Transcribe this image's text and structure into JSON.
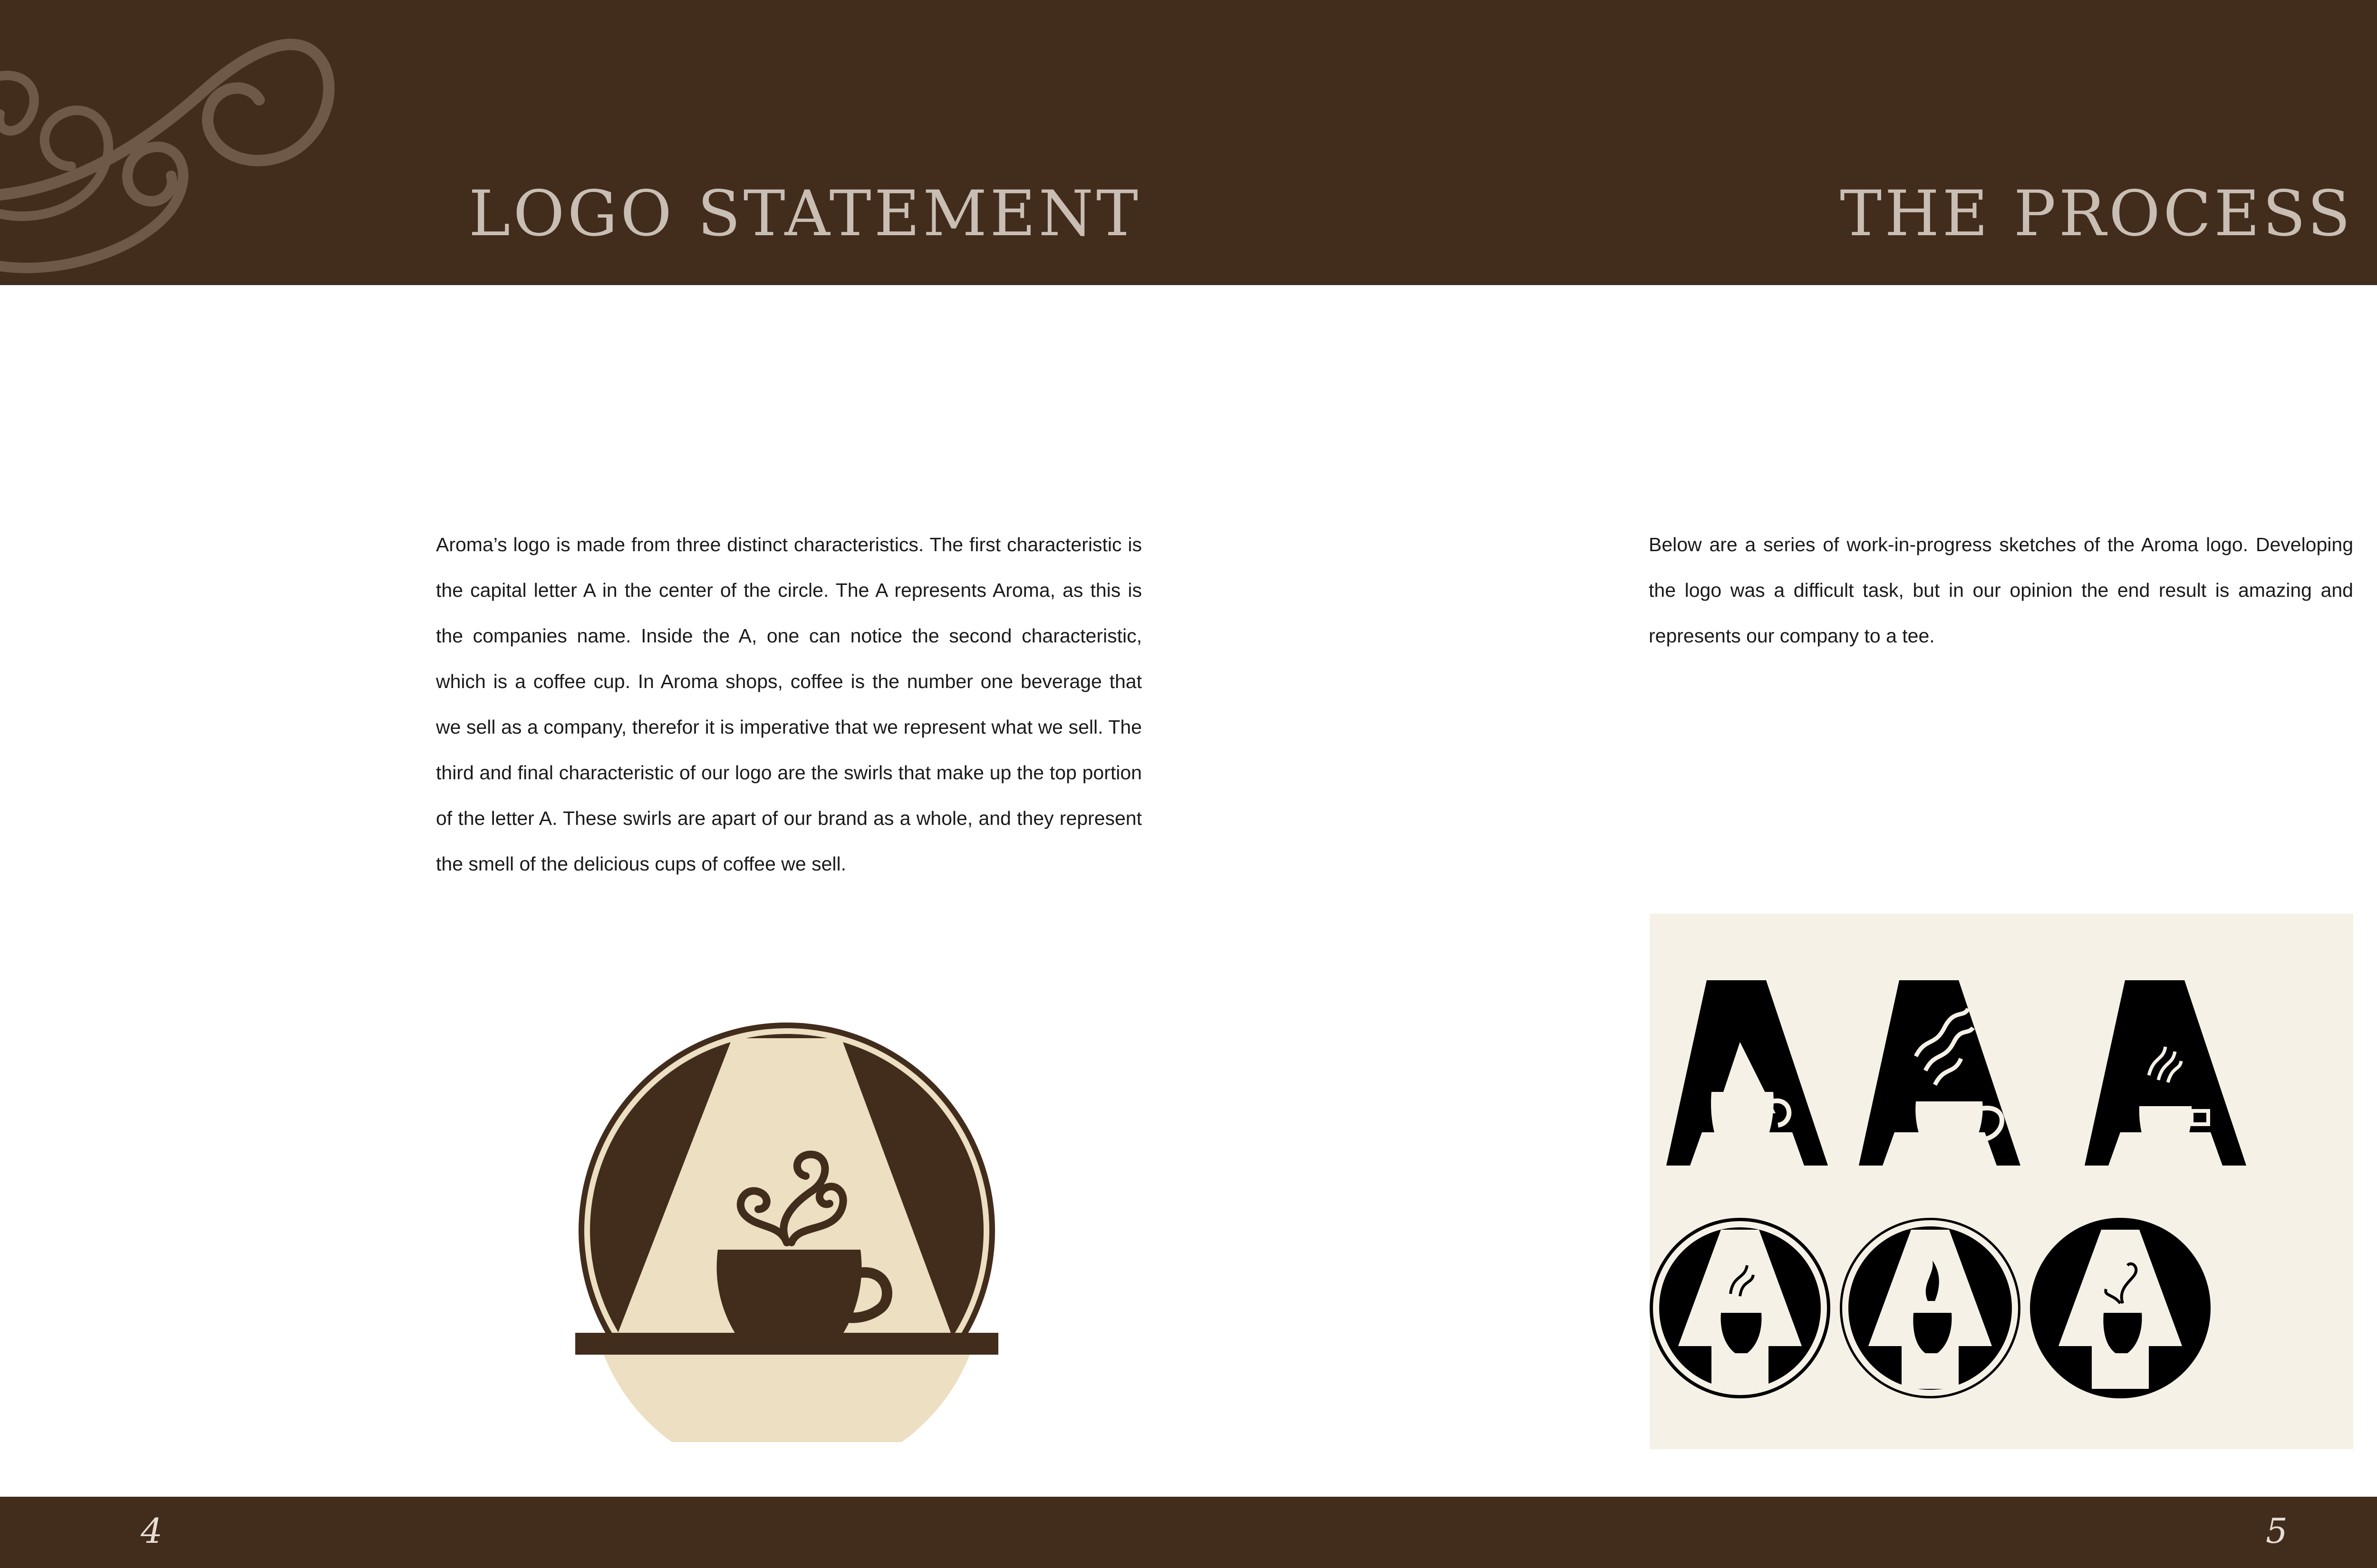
{
  "left_page": {
    "heading": "LOGO STATEMENT",
    "body": "Aroma’s logo is made from three distinct characteristics. The first characteristic is the capital letter A in the center of the circle. The A represents Aroma, as this is the companies name. Inside the A, one can notice the second characteristic, which is a coffee cup. In Aroma shops, coffee is the number one beverage that we sell as a company, therefor it is imperative that we represent what we sell. The third and final characteristic of our logo are the swirls that make up the top portion of the letter A. These swirls are apart of our brand as a whole, and they represent the smell of the delicious cups of coffee we sell.",
    "page_number": "4"
  },
  "right_page": {
    "heading": "THE PROCESS",
    "body": "Below are a series of work-in-progress sketches of the Aroma logo. Developing the logo was a difficult task, but in our opinion the end result is amazing and represents our company to a tee.",
    "page_number": "5"
  },
  "colors": {
    "band_brown": "#422c1c",
    "heading_tan": "#c9beb3",
    "logo_cream": "#ecdfc2",
    "sketch_panel": "#f6f1e6"
  },
  "images": {
    "main_logo": "aroma-logo-letter-a-coffee-cup-swirls",
    "sketches": [
      "sketch-a-plain-cup",
      "sketch-a-wavy-steam-cup",
      "sketch-a-small-steam-cup",
      "sketch-circle-a-steam-cup",
      "sketch-circle-a-flame-cup",
      "sketch-circle-a-swirl-cup"
    ]
  }
}
